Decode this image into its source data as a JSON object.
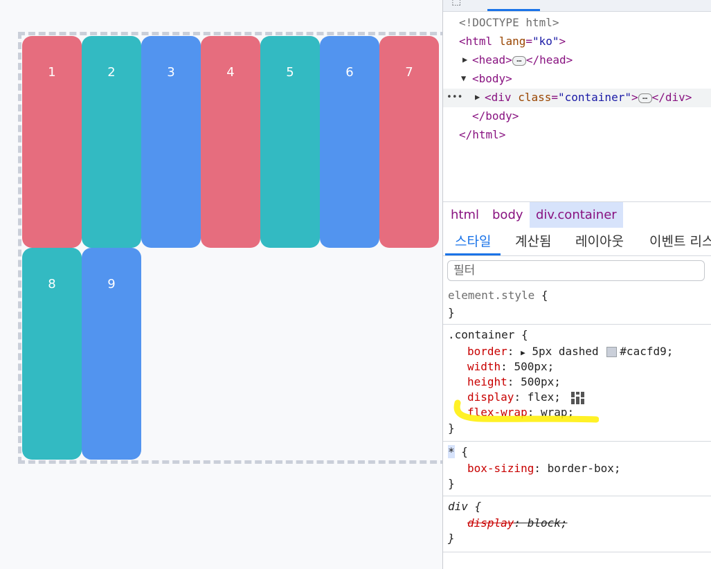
{
  "preview": {
    "boxes": [
      {
        "label": "1",
        "color": "#e66d7e"
      },
      {
        "label": "2",
        "color": "#33bac2"
      },
      {
        "label": "3",
        "color": "#5294ef"
      },
      {
        "label": "4",
        "color": "#e66d7e"
      },
      {
        "label": "5",
        "color": "#33bac2"
      },
      {
        "label": "6",
        "color": "#5294ef"
      },
      {
        "label": "7",
        "color": "#e66d7e"
      },
      {
        "label": "8",
        "color": "#33bac2"
      },
      {
        "label": "9",
        "color": "#5294ef"
      }
    ],
    "container_border_color": "#cacfd9"
  },
  "devtools": {
    "dom": {
      "doctype": "<!DOCTYPE html>",
      "html_open_tag": "html",
      "html_attr_name": "lang",
      "html_attr_value": "\"ko\"",
      "head_tag": "head",
      "body_tag": "body",
      "div_tag": "div",
      "div_attr_name": "class",
      "div_attr_value": "\"container\"",
      "body_close": "</body>",
      "html_close": "</html>",
      "row_dots": "•••"
    },
    "breadcrumb": [
      "html",
      "body",
      "div.container"
    ],
    "sub_tabs": [
      "스타일",
      "계산됨",
      "레이아웃",
      "이벤트 리스"
    ],
    "filter_placeholder": "필터",
    "styles": {
      "element_style_selector": "element.style",
      "container_selector": ".container",
      "container_props": [
        {
          "name": "border",
          "value": "5px dashed",
          "color_value": "#cacfd9;"
        },
        {
          "name": "width",
          "value": "500px;"
        },
        {
          "name": "height",
          "value": "500px;"
        },
        {
          "name": "display",
          "value": "flex;"
        },
        {
          "name": "flex-wrap",
          "value": "wrap;"
        }
      ],
      "universal_selector": "*",
      "universal_props": [
        {
          "name": "box-sizing",
          "value": "border-box;"
        }
      ],
      "div_selector": "div",
      "div_props": [
        {
          "name": "display",
          "value": "block;"
        }
      ],
      "open_brace": "{",
      "close_brace": "}"
    },
    "highlight_color": "#ffee00"
  }
}
